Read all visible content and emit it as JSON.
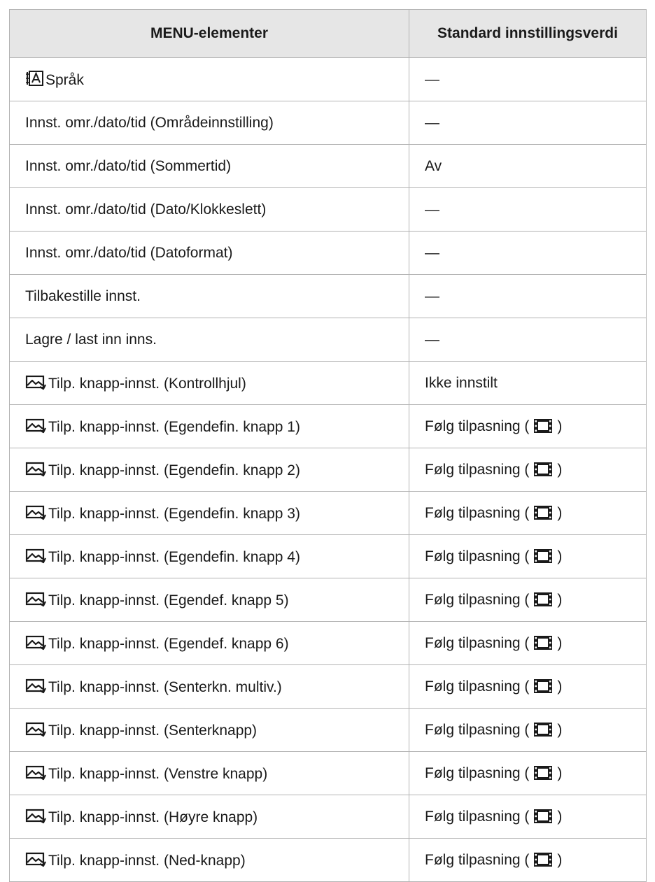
{
  "table": {
    "headers": [
      "MENU-elementer",
      "Standard innstillingsverdi"
    ],
    "rows": [
      {
        "icon": "language-icon",
        "item": "Språk",
        "value": "—"
      },
      {
        "icon": "",
        "item": "Innst. omr./dato/tid (Områdeinnstilling)",
        "value": "—"
      },
      {
        "icon": "",
        "item": "Innst. omr./dato/tid (Sommertid)",
        "value": "Av"
      },
      {
        "icon": "",
        "item": "Innst. omr./dato/tid (Dato/Klokkeslett)",
        "value": "—"
      },
      {
        "icon": "",
        "item": "Innst. omr./dato/tid (Datoformat)",
        "value": "—"
      },
      {
        "icon": "",
        "item": "Tilbakestille innst.",
        "value": "—"
      },
      {
        "icon": "",
        "item": "Lagre / last inn inns.",
        "value": "—"
      },
      {
        "icon": "still-image-icon",
        "item": "Tilp. knapp-innst. (Kontrollhjul)",
        "value": "Ikke innstilt"
      },
      {
        "icon": "still-image-icon",
        "item": "Tilp. knapp-innst. (Egendefin. knapp 1)",
        "value": "Følg tilpasning (",
        "value_icon": "movie-icon",
        "value_suffix": ")"
      },
      {
        "icon": "still-image-icon",
        "item": "Tilp. knapp-innst. (Egendefin. knapp 2)",
        "value": "Følg tilpasning (",
        "value_icon": "movie-icon",
        "value_suffix": ")"
      },
      {
        "icon": "still-image-icon",
        "item": "Tilp. knapp-innst. (Egendefin. knapp 3)",
        "value": "Følg tilpasning (",
        "value_icon": "movie-icon",
        "value_suffix": ")"
      },
      {
        "icon": "still-image-icon",
        "item": "Tilp. knapp-innst. (Egendefin. knapp 4)",
        "value": "Følg tilpasning (",
        "value_icon": "movie-icon",
        "value_suffix": ")"
      },
      {
        "icon": "still-image-icon",
        "item": "Tilp. knapp-innst. (Egendef. knapp 5)",
        "value": "Følg tilpasning (",
        "value_icon": "movie-icon",
        "value_suffix": ")"
      },
      {
        "icon": "still-image-icon",
        "item": "Tilp. knapp-innst. (Egendef. knapp 6)",
        "value": "Følg tilpasning (",
        "value_icon": "movie-icon",
        "value_suffix": ")"
      },
      {
        "icon": "still-image-icon",
        "item": "Tilp. knapp-innst. (Senterkn. multiv.)",
        "value": "Følg tilpasning (",
        "value_icon": "movie-icon",
        "value_suffix": ")"
      },
      {
        "icon": "still-image-icon",
        "item": "Tilp. knapp-innst. (Senterknapp)",
        "value": "Følg tilpasning (",
        "value_icon": "movie-icon",
        "value_suffix": ")"
      },
      {
        "icon": "still-image-icon",
        "item": "Tilp. knapp-innst. (Venstre knapp)",
        "value": "Følg tilpasning (",
        "value_icon": "movie-icon",
        "value_suffix": ")"
      },
      {
        "icon": "still-image-icon",
        "item": "Tilp. knapp-innst. (Høyre knapp)",
        "value": "Følg tilpasning (",
        "value_icon": "movie-icon",
        "value_suffix": ")"
      },
      {
        "icon": "still-image-icon",
        "item": "Tilp. knapp-innst. (Ned-knapp)",
        "value": "Følg tilpasning (",
        "value_icon": "movie-icon",
        "value_suffix": ")"
      }
    ]
  }
}
